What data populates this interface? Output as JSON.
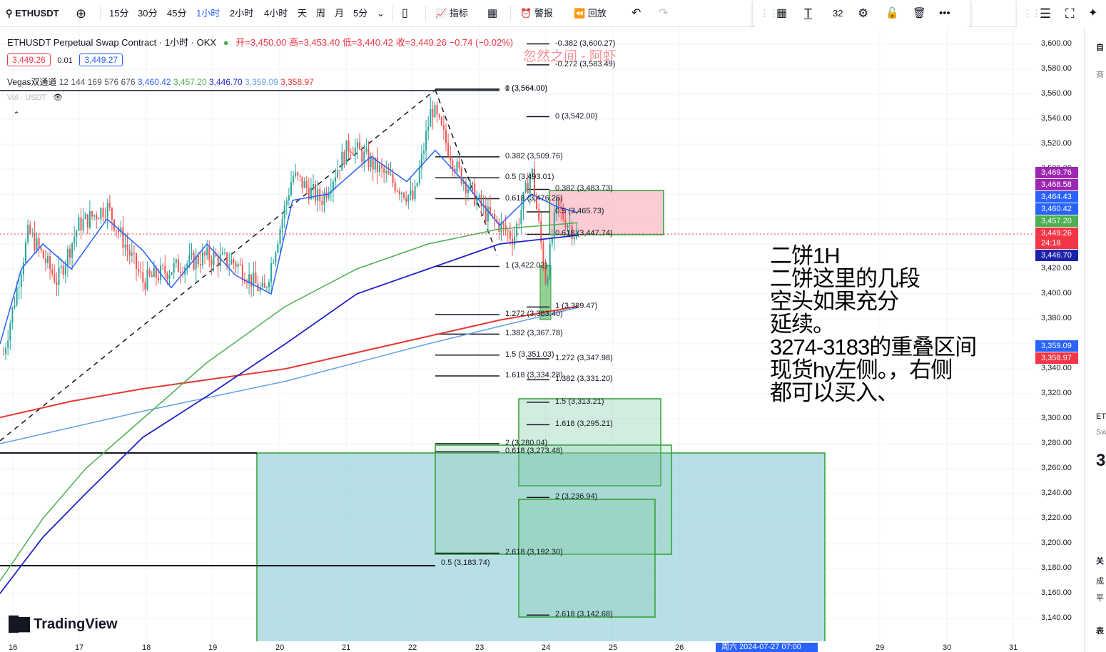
{
  "toolbar": {
    "symbol": "ETHUSDT",
    "intervals": [
      "15分",
      "30分",
      "45分",
      "1小时",
      "2小时",
      "4小时",
      "天",
      "周",
      "月",
      "5分"
    ],
    "active_interval": "1小时",
    "indicators_label": "指标",
    "alert_label": "警报",
    "replay_label": "回放"
  },
  "floatbar": {
    "size": "32"
  },
  "legend": {
    "title": "ETHUSDT Perpetual Swap Contract · 1小时 · OKX",
    "open": "开=3,450.00",
    "high": "高=3,453.40",
    "low": "低=3,440.42",
    "close": "收=3,449.26",
    "change": "−0.74 (−0.02%)",
    "bid": "3,449.26",
    "spread": "0.01",
    "ask": "3,449.27",
    "vegas_label": "Vegas双通道",
    "vegas_params": "12 144 169 576 676",
    "vegas_values": [
      "3,460.42",
      "3,457.20",
      "3,446.70",
      "3,359.09",
      "3,358.97"
    ],
    "vol_label": "Vol · USDT"
  },
  "watermark": "忽然之间 - 阿虾",
  "note_lines": [
    "二饼1H",
    "二饼这里的几段",
    "空头如果充分",
    "延续。",
    "3274-3183的重叠区间",
    "现货hy左侧。，右侧",
    "都可以买入、"
  ],
  "price_axis": [
    "3,600.00",
    "3,580.00",
    "3,560.00",
    "3,540.00",
    "3,520.00",
    "3,500.00",
    "3,420.00",
    "3,400.00",
    "3,380.00",
    "3,340.00",
    "3,320.00",
    "3,300.00",
    "3,280.00",
    "3,260.00",
    "3,240.00",
    "3,220.00",
    "3,200.00",
    "3,180.00",
    "3,160.00",
    "3,140.00"
  ],
  "price_tags": [
    {
      "v": "3,469.76",
      "c": "#9c27b0"
    },
    {
      "v": "3,468.58",
      "c": "#9c27b0"
    },
    {
      "v": "3,464.43",
      "c": "#2962ff"
    },
    {
      "v": "3,460.42",
      "c": "#2962ff"
    },
    {
      "v": "3,457.20",
      "c": "#4caf50"
    },
    {
      "v": "3,449.26",
      "c": "#f23645"
    },
    {
      "v": "24:18",
      "c": "#f23645"
    },
    {
      "v": "3,446.70",
      "c": "#1e22aa"
    },
    {
      "v": "3,359.09",
      "c": "#2962ff"
    },
    {
      "v": "3,358.97",
      "c": "#f23645"
    }
  ],
  "x_axis": [
    "16",
    "17",
    "18",
    "19",
    "20",
    "21",
    "22",
    "23",
    "24",
    "25",
    "26",
    "29",
    "30",
    "31"
  ],
  "x_crosshair": "周六 2024-07-27   07:00",
  "fib_labels": [
    "-0.382 (3,600.27)",
    "-0.272 (3,583.49)",
    "1 (3,564.00)",
    "0 (3,564.00)",
    "0 (3,542.00)",
    "0.382 (3,509.76)",
    "0.5 (3,493.01)",
    "0.618 (3,476.26)",
    "0.382 (3,483.73)",
    "0.5 (3,465.73)",
    "0.618 (3,447.74)",
    "1 (3,422.02)",
    "1 (3,389.47)",
    "1.272 (3,383.40)",
    "1.382 (3,367.78)",
    "1.5 (3,351.03)",
    "1.272 (3,347.98)",
    "1.618 (3,334.28)",
    "1.382 (3,331.20)",
    "1.5 (3,313.21)",
    "1.618 (3,295.21)",
    "2 (3,280.04)",
    "0.618 (3,273.48)",
    "2 (3,236.94)",
    "2.618 (3,192.30)",
    "0.5 (3,183.74)",
    "2.618 (3,142.68)"
  ],
  "logo": "TradingView",
  "right_panel": [
    "自",
    "商",
    "ET",
    "Sw",
    "3",
    "关",
    "成",
    "平",
    "表"
  ]
}
